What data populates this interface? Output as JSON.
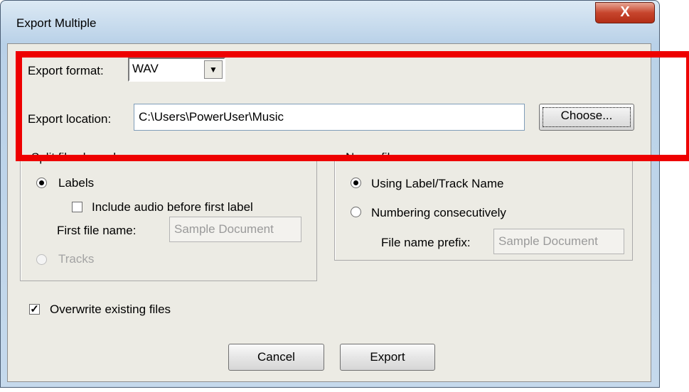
{
  "window": {
    "title": "Export Multiple",
    "close_glyph": "X"
  },
  "export_format": {
    "label": "Export format:",
    "value": "WAV"
  },
  "export_location": {
    "label": "Export location:",
    "value": "C:\\Users\\PowerUser\\Music",
    "choose_label": "Choose..."
  },
  "split_group": {
    "title": "Split files based on:",
    "labels_option": "Labels",
    "include_audio_label": "Include audio before first label",
    "first_file_label": "First file name:",
    "first_file_value": "Sample Document",
    "tracks_option": "Tracks"
  },
  "name_group": {
    "title": "Name files:",
    "using_label_option": "Using Label/Track Name",
    "numbering_option": "Numbering consecutively",
    "prefix_label": "File name prefix:",
    "prefix_value": "Sample Document"
  },
  "overwrite": {
    "label": "Overwrite existing files",
    "checked": true
  },
  "buttons": {
    "cancel": "Cancel",
    "export": "Export"
  },
  "annotation": {
    "color": "#ee0000"
  }
}
